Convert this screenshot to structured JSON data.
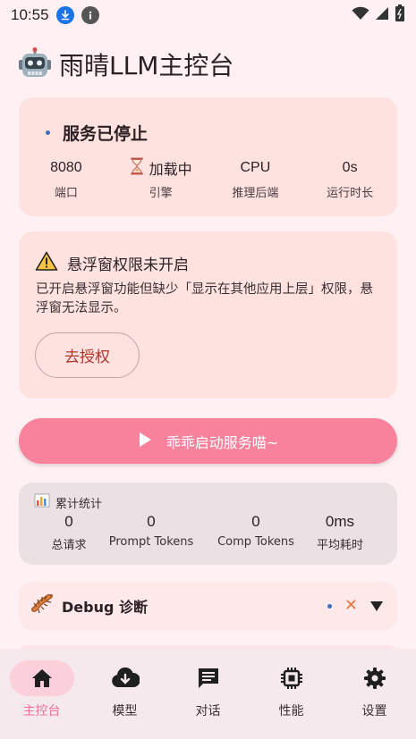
{
  "status_bar": {
    "time": "10:55"
  },
  "app": {
    "title": "雨晴LLM主控台"
  },
  "service": {
    "status": "服务已停止",
    "metrics": [
      {
        "value": "8080",
        "label": "端口"
      },
      {
        "value": "加载中",
        "label": "引擎"
      },
      {
        "value": "CPU",
        "label": "推理后端"
      },
      {
        "value": "0s",
        "label": "运行时长"
      }
    ]
  },
  "permission": {
    "title": "悬浮窗权限未开启",
    "description": "已开启悬浮窗功能但缺少「显示在其他应用上层」权限，悬浮窗无法显示。",
    "button": "去授权"
  },
  "start_button": {
    "label": "乖乖启动服务喵~"
  },
  "stats": {
    "title": "累计统计",
    "items": [
      {
        "value": "0",
        "label": "总请求"
      },
      {
        "value": "0",
        "label": "Prompt Tokens"
      },
      {
        "value": "0",
        "label": "Comp Tokens"
      },
      {
        "value": "0ms",
        "label": "平均耗时"
      }
    ]
  },
  "debug": {
    "title": "Debug 诊断"
  },
  "nav": {
    "items": [
      {
        "label": "主控台",
        "icon": "home-icon",
        "active": true
      },
      {
        "label": "模型",
        "icon": "cloud-download-icon"
      },
      {
        "label": "对话",
        "icon": "chat-icon"
      },
      {
        "label": "性能",
        "icon": "chip-icon"
      },
      {
        "label": "设置",
        "icon": "gear-icon"
      }
    ]
  },
  "colors": {
    "background": "#fff0f3",
    "card": "#fde2df",
    "accent": "#f8829c",
    "nav_active": "#f0709a"
  }
}
